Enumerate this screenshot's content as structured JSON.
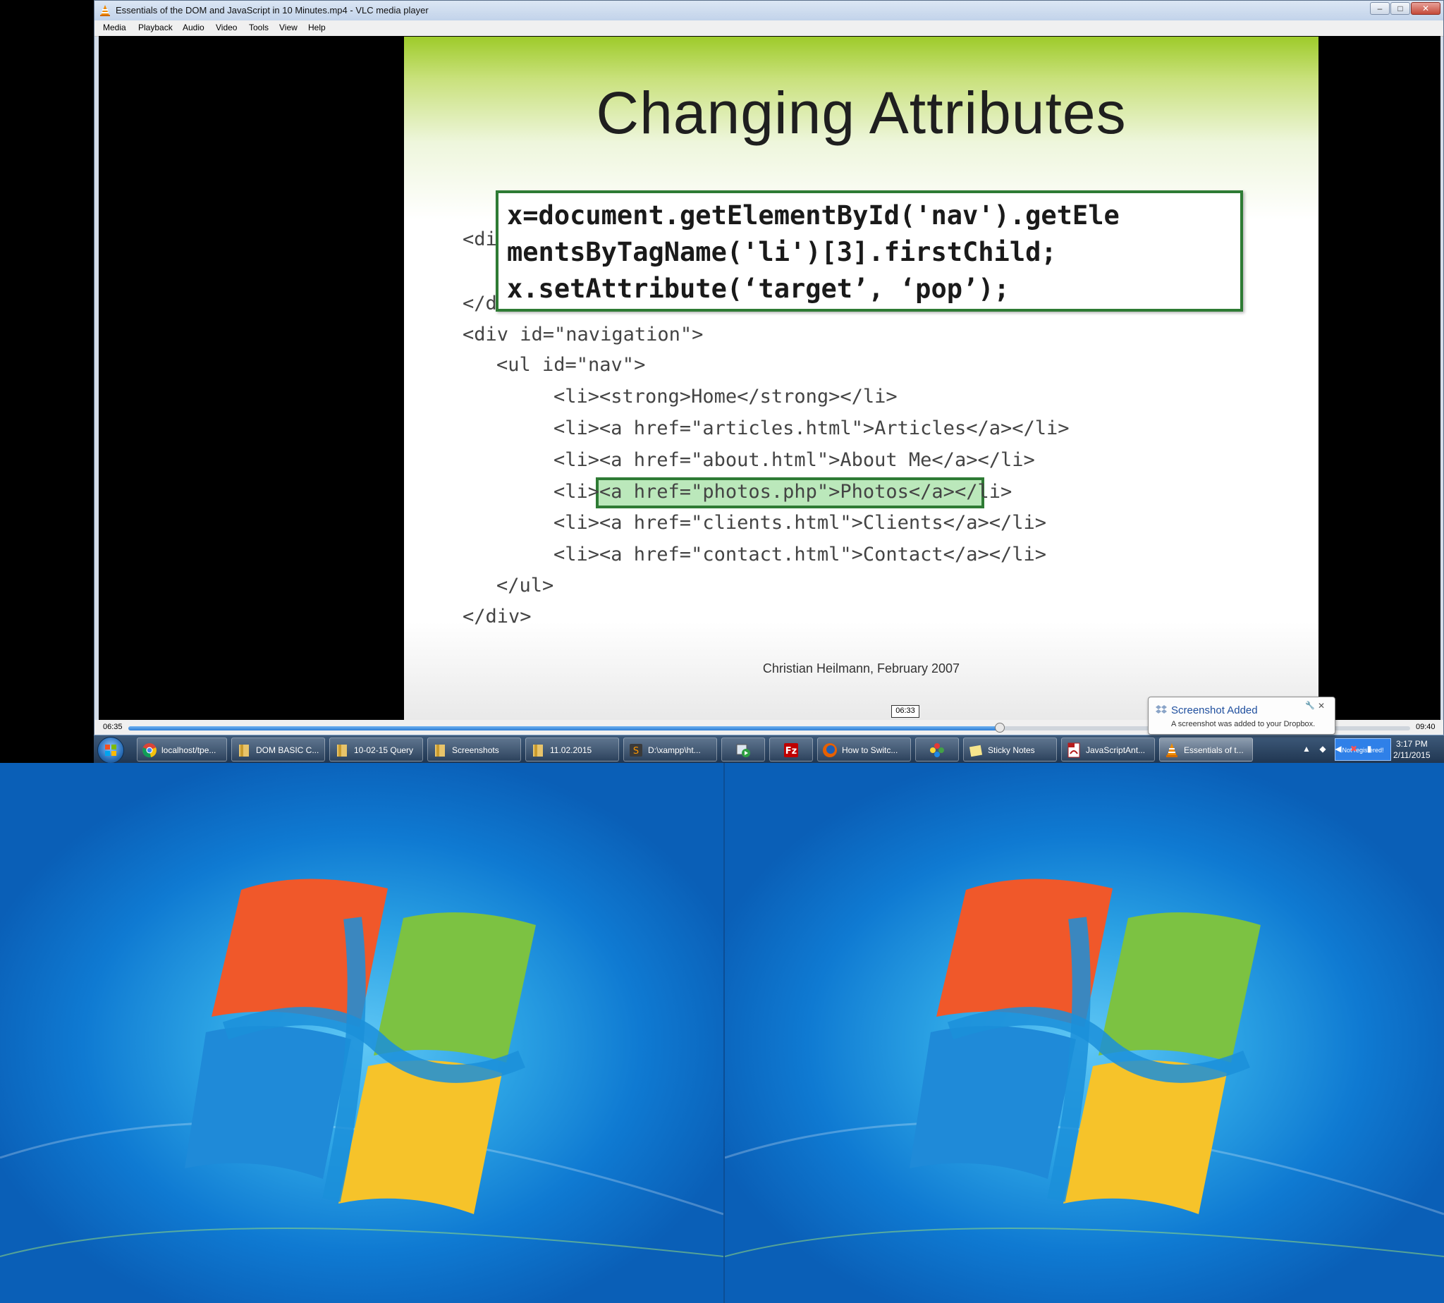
{
  "window": {
    "title": "Essentials of the DOM and JavaScript in 10 Minutes.mp4 - VLC media player",
    "minimize": "–",
    "maximize": "□",
    "close": "✕"
  },
  "menu": [
    "Media",
    "Playback",
    "Audio",
    "Video",
    "Tools",
    "View",
    "Help"
  ],
  "slide": {
    "title": "Changing Attributes",
    "box_lines": [
      "x=document.getElementById('nav').getEle",
      "mentsByTagName('li')[3].firstChild;",
      "x.setAttribute(‘target’, ‘pop’);"
    ],
    "code_lines": [
      "<di",
      "</d",
      "<div id=\"navigation\">",
      "<ul id=\"nav\">",
      "<li><strong>Home</strong></li>",
      "<li><a href=\"articles.html\">Articles</a></li>",
      "<li><a href=\"about.html\">About Me</a></li>",
      "<li><a href=\"photos.php\">Photos</a></li>",
      "<li><a href=\"clients.html\">Clients</a></li>",
      "<li><a href=\"contact.html\">Contact</a></li>",
      "</ul>",
      "</div>"
    ],
    "footer": "Christian Heilmann, February 2007"
  },
  "playback": {
    "elapsed": "06:35",
    "total": "09:40",
    "hover_time": "06:33",
    "progress": 0.68
  },
  "taskbar": {
    "items": [
      {
        "label": "localhost/tpe...",
        "icon": "chrome-icon"
      },
      {
        "label": "DOM BASIC C...",
        "icon": "folder-icon"
      },
      {
        "label": "10-02-15 Query",
        "icon": "folder-icon"
      },
      {
        "label": "Screenshots",
        "icon": "folder-icon"
      },
      {
        "label": "11.02.2015",
        "icon": "folder-icon"
      },
      {
        "label": "D:\\xampp\\ht...",
        "icon": "sublime-icon"
      },
      {
        "label": "",
        "icon": "media-app-icon"
      },
      {
        "label": "",
        "icon": "filezilla-icon"
      },
      {
        "label": "How to Switc...",
        "icon": "firefox-icon"
      },
      {
        "label": "",
        "icon": "pinwheel-icon"
      },
      {
        "label": "Sticky Notes",
        "icon": "sticky-notes-icon"
      },
      {
        "label": "JavaScriptAnt...",
        "icon": "pdf-icon"
      },
      {
        "label": "Essentials of t...",
        "icon": "vlc-icon"
      }
    ],
    "not_registered": "Not registered!",
    "clock_time": "3:17 PM",
    "clock_date": "2/11/2015"
  },
  "notification": {
    "title": "Screenshot Added",
    "body": "A screenshot was added to your Dropbox.",
    "close": "✕",
    "pin": "🔧"
  },
  "colors": {
    "taskbar": "#1f3550",
    "slide_green": "#9ecb2a",
    "highlight_border": "#2e7b34",
    "desktop_blue": "#0f7ad2"
  }
}
